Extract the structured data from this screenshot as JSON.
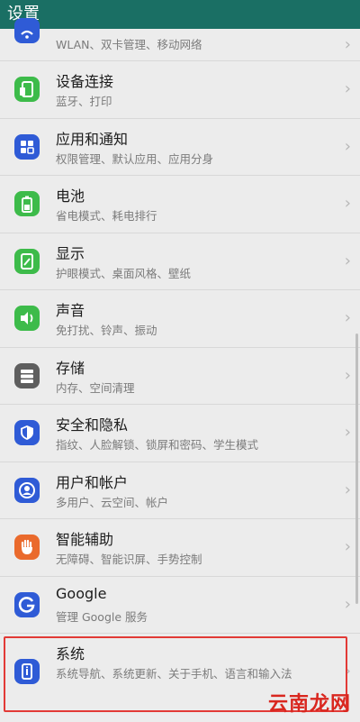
{
  "header": {
    "title": "设置"
  },
  "items": [
    {
      "title": "",
      "subtitle": "WLAN、双卡管理、移动网络",
      "icon": "wifi-icon",
      "color": "#2f5bd6"
    },
    {
      "title": "设备连接",
      "subtitle": "蓝牙、打印",
      "icon": "device-connection-icon",
      "color": "#3dbb4a"
    },
    {
      "title": "应用和通知",
      "subtitle": "权限管理、默认应用、应用分身",
      "icon": "apps-grid-icon",
      "color": "#2f5bd6"
    },
    {
      "title": "电池",
      "subtitle": "省电模式、耗电排行",
      "icon": "battery-icon",
      "color": "#3dbb4a"
    },
    {
      "title": "显示",
      "subtitle": "护眼模式、桌面风格、壁纸",
      "icon": "display-icon",
      "color": "#3dbb4a"
    },
    {
      "title": "声音",
      "subtitle": "免打扰、铃声、振动",
      "icon": "speaker-icon",
      "color": "#3dbb4a"
    },
    {
      "title": "存储",
      "subtitle": "内存、空间清理",
      "icon": "storage-icon",
      "color": "#5e5e5e"
    },
    {
      "title": "安全和隐私",
      "subtitle": "指纹、人脸解锁、锁屏和密码、学生模式",
      "icon": "shield-icon",
      "color": "#2f5bd6"
    },
    {
      "title": "用户和帐户",
      "subtitle": "多用户、云空间、帐户",
      "icon": "user-icon",
      "color": "#2f5bd6"
    },
    {
      "title": "智能辅助",
      "subtitle": "无障碍、智能识屏、手势控制",
      "icon": "hand-icon",
      "color": "#ea6a2c"
    },
    {
      "title": "Google",
      "subtitle": "管理 Google 服务",
      "icon": "google-icon",
      "color": "#2f5bd6"
    },
    {
      "title": "系统",
      "subtitle": "系统导航、系统更新、关于手机、语言和输入法",
      "icon": "phone-info-icon",
      "color": "#2f5bd6"
    }
  ],
  "chevron": "›",
  "watermark": "云南龙网"
}
